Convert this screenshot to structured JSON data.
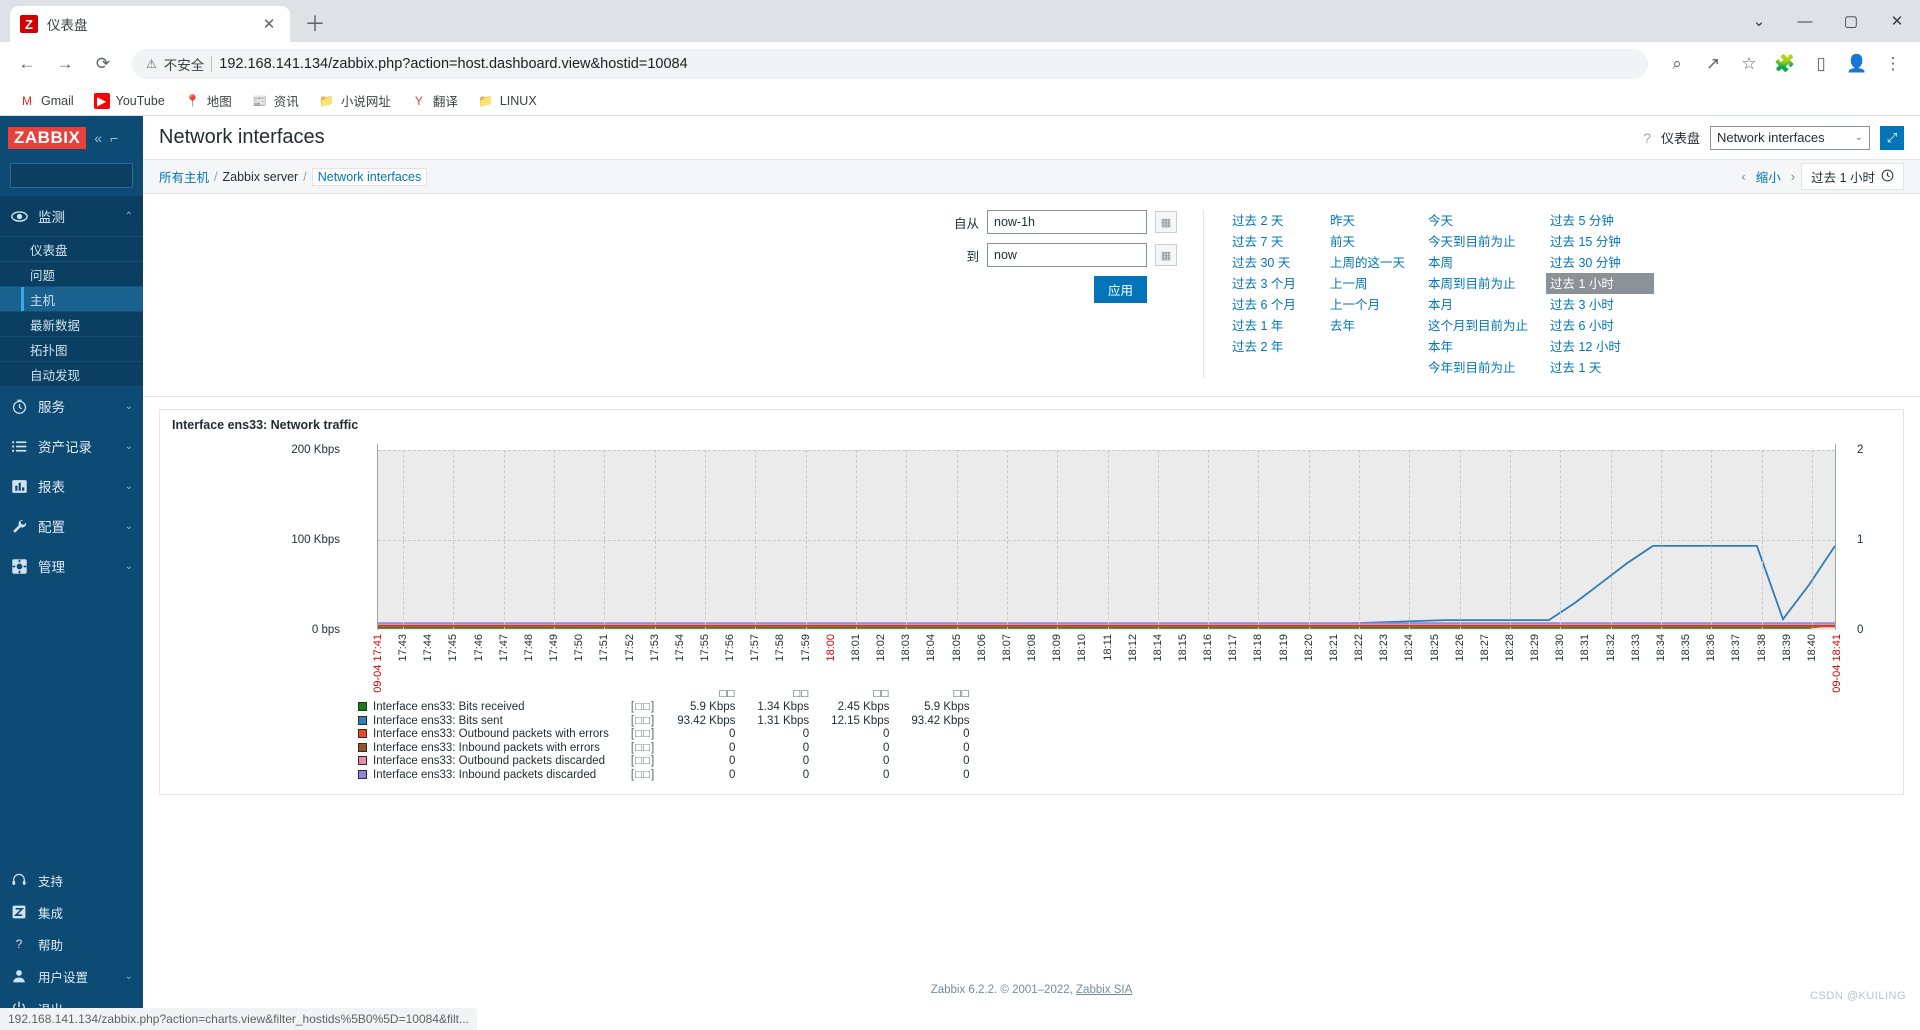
{
  "browser": {
    "tab": {
      "title": "仪表盘",
      "favicon_letter": "Z",
      "close_glyph": "✕"
    },
    "newtab_glyph": "＋",
    "window_controls": {
      "minimize": "—",
      "maximize": "▢",
      "close": "✕",
      "chevron": "⌄"
    },
    "nav": {
      "back": "←",
      "forward": "→",
      "reload": "⟳"
    },
    "omnibox": {
      "warn_glyph": "⚠",
      "security_label": "不安全",
      "url": "192.168.141.134/zabbix.php?action=host.dashboard.view&hostid=10084"
    },
    "toolbar_right": [
      {
        "name": "zoom-search-icon",
        "glyph": "⌕"
      },
      {
        "name": "share-icon",
        "glyph": "↗"
      },
      {
        "name": "bookmark-star-icon",
        "glyph": "☆"
      },
      {
        "name": "extensions-icon",
        "glyph": "🧩"
      },
      {
        "name": "sidepanel-icon",
        "glyph": "▯"
      },
      {
        "name": "profile-icon",
        "glyph": "👤"
      },
      {
        "name": "menu-icon",
        "glyph": "⋮"
      }
    ],
    "bookmarks": [
      {
        "label": "Gmail",
        "icon": "M",
        "color": "#d93025",
        "bg": "transparent"
      },
      {
        "label": "YouTube",
        "icon": "▶",
        "color": "#ffffff",
        "bg": "#ff0000"
      },
      {
        "label": "地图",
        "icon": "📍",
        "color": "#ffffff",
        "bg": "transparent"
      },
      {
        "label": "资讯",
        "icon": "📰",
        "color": "#ffffff",
        "bg": "transparent"
      },
      {
        "label": "小说网址",
        "icon": "📁",
        "color": "#f7cb4d",
        "bg": "transparent"
      },
      {
        "label": "翻译",
        "icon": "Y",
        "color": "#e8403a",
        "bg": "transparent"
      },
      {
        "label": "LINUX",
        "icon": "📁",
        "color": "#f7cb4d",
        "bg": "transparent"
      }
    ],
    "status_bar": "192.168.141.134/zabbix.php?action=charts.view&filter_hostids%5B0%5D=10084&filt..."
  },
  "sidebar": {
    "logo": "ZABBIX",
    "collapse_glyph": "«",
    "hide_glyph": "⌐",
    "search_placeholder": "",
    "groups": [
      {
        "label": "监测",
        "icon": "eye-icon",
        "expanded": true,
        "chevron": "⌃",
        "items": [
          {
            "label": "仪表盘",
            "selected": false
          },
          {
            "label": "问题",
            "selected": false
          },
          {
            "label": "主机",
            "selected": true
          },
          {
            "label": "最新数据",
            "selected": false
          },
          {
            "label": "拓扑图",
            "selected": false
          },
          {
            "label": "自动发现",
            "selected": false
          }
        ]
      },
      {
        "label": "服务",
        "icon": "clock-icon",
        "expanded": false,
        "chevron": "⌄",
        "items": []
      },
      {
        "label": "资产记录",
        "icon": "list-icon",
        "expanded": false,
        "chevron": "⌄",
        "items": []
      },
      {
        "label": "报表",
        "icon": "chart-icon",
        "expanded": false,
        "chevron": "⌄",
        "items": []
      },
      {
        "label": "配置",
        "icon": "wrench-icon",
        "expanded": false,
        "chevron": "⌄",
        "items": []
      },
      {
        "label": "管理",
        "icon": "gear-icon",
        "expanded": false,
        "chevron": "⌄",
        "items": []
      }
    ],
    "bottom": [
      {
        "label": "支持",
        "icon": "headset-icon",
        "chevron": ""
      },
      {
        "label": "集成",
        "icon": "zabbix-z-icon",
        "chevron": ""
      },
      {
        "label": "帮助",
        "icon": "question-icon",
        "chevron": ""
      },
      {
        "label": "用户设置",
        "icon": "user-icon",
        "chevron": "⌄"
      },
      {
        "label": "退出",
        "icon": "power-icon",
        "chevron": ""
      }
    ]
  },
  "header": {
    "title": "Network interfaces",
    "help_glyph": "?",
    "dashboard_label": "仪表盘",
    "dashboard_selected": "Network interfaces",
    "dashboard_chevron": "⌄",
    "kiosk_glyph": "⤢"
  },
  "breadcrumb": {
    "items": [
      {
        "label": "所有主机",
        "type": "link"
      },
      {
        "label": "Zabbix server",
        "type": "text"
      },
      {
        "label": "Network interfaces",
        "type": "selected"
      }
    ],
    "separator": "/",
    "zoom_prev": "‹",
    "zoom_label": "缩小",
    "zoom_next": "›",
    "range_label": "过去 1 小时",
    "clock_glyph": "🕘"
  },
  "timepanel": {
    "from_label": "自从",
    "from_value": "now-1h",
    "to_label": "到",
    "to_value": "now",
    "calendar_glyph": "▦",
    "apply_label": "应用",
    "columns": [
      {
        "options": [
          {
            "label": "过去 2 天",
            "selected": false
          },
          {
            "label": "过去 7 天",
            "selected": false
          },
          {
            "label": "过去 30 天",
            "selected": false
          },
          {
            "label": "过去 3 个月",
            "selected": false
          },
          {
            "label": "过去 6 个月",
            "selected": false
          },
          {
            "label": "过去 1 年",
            "selected": false
          },
          {
            "label": "过去 2 年",
            "selected": false
          }
        ]
      },
      {
        "options": [
          {
            "label": "昨天",
            "selected": false
          },
          {
            "label": "前天",
            "selected": false
          },
          {
            "label": "上周的这一天",
            "selected": false
          },
          {
            "label": "上一周",
            "selected": false
          },
          {
            "label": "上一个月",
            "selected": false
          },
          {
            "label": "去年",
            "selected": false
          }
        ]
      },
      {
        "options": [
          {
            "label": "今天",
            "selected": false
          },
          {
            "label": "今天到目前为止",
            "selected": false
          },
          {
            "label": "本周",
            "selected": false
          },
          {
            "label": "本周到目前为止",
            "selected": false
          },
          {
            "label": "本月",
            "selected": false
          },
          {
            "label": "这个月到目前为止",
            "selected": false
          },
          {
            "label": "本年",
            "selected": false
          },
          {
            "label": "今年到目前为止",
            "selected": false
          }
        ]
      },
      {
        "options": [
          {
            "label": "过去 5 分钟",
            "selected": false
          },
          {
            "label": "过去 15 分钟",
            "selected": false
          },
          {
            "label": "过去 30 分钟",
            "selected": false
          },
          {
            "label": "过去 1 小时",
            "selected": true
          },
          {
            "label": "过去 3 小时",
            "selected": false
          },
          {
            "label": "过去 6 小时",
            "selected": false
          },
          {
            "label": "过去 12 小时",
            "selected": false
          },
          {
            "label": "过去 1 天",
            "selected": false
          }
        ]
      }
    ]
  },
  "widget": {
    "title": "Interface ens33: Network traffic"
  },
  "chart_data": {
    "type": "line",
    "title": "Interface ens33: Network traffic",
    "xlabel": "",
    "ylabel": "",
    "grid": true,
    "legend_position": "bottom",
    "y_left": {
      "ticks": [
        "0 bps",
        "100 Kbps",
        "200 Kbps"
      ],
      "values": [
        0,
        100000,
        200000
      ],
      "ylim": [
        0,
        200000
      ]
    },
    "y_right": {
      "ticks": [
        "0",
        "1",
        "2"
      ],
      "values": [
        0,
        1,
        2
      ],
      "ylim": [
        0,
        2
      ]
    },
    "x_start_label": "09-04 17:41",
    "x_end_label": "09-04 18:41",
    "x": [
      "17:43",
      "17:44",
      "17:45",
      "17:46",
      "17:47",
      "17:48",
      "17:49",
      "17:50",
      "17:51",
      "17:52",
      "17:53",
      "17:54",
      "17:55",
      "17:56",
      "17:57",
      "17:58",
      "17:59",
      "18:00",
      "18:01",
      "18:02",
      "18:03",
      "18:04",
      "18:05",
      "18:06",
      "18:07",
      "18:08",
      "18:09",
      "18:10",
      "18:11",
      "18:12",
      "18:14",
      "18:15",
      "18:16",
      "18:17",
      "18:18",
      "18:19",
      "18:20",
      "18:21",
      "18:22",
      "18:23",
      "18:24",
      "18:25",
      "18:26",
      "18:27",
      "18:28",
      "18:29",
      "18:30",
      "18:31",
      "18:32",
      "18:33",
      "18:34",
      "18:35",
      "18:36",
      "18:37",
      "18:38",
      "18:39",
      "18:40"
    ],
    "x_highlight": "18:00",
    "series": [
      {
        "name": "Interface ens33: Bits received",
        "color": "#1a7a1a",
        "axis": "left",
        "values": [
          2450,
          2450,
          2450,
          2450,
          2450,
          2450,
          2450,
          2450,
          2450,
          2450,
          2450,
          2450,
          2450,
          2450,
          2450,
          2450,
          2450,
          2450,
          2450,
          2450,
          2450,
          2450,
          2450,
          2450,
          2450,
          2450,
          2450,
          2450,
          2450,
          2450,
          2450,
          2450,
          2450,
          2450,
          2450,
          2450,
          2450,
          2450,
          2450,
          2450,
          2450,
          2450,
          2450,
          2450,
          2450,
          2450,
          2450,
          2450,
          2450,
          2450,
          2450,
          2450,
          2450,
          2450,
          2450,
          2450,
          5900
        ]
      },
      {
        "name": "Interface ens33: Bits sent",
        "color": "#2f7cb8",
        "axis": "left",
        "values": [
          7000,
          7000,
          7000,
          7000,
          7000,
          7000,
          7000,
          7000,
          7000,
          7000,
          7000,
          7000,
          7000,
          7000,
          7000,
          7000,
          7000,
          7000,
          7000,
          7000,
          7000,
          7000,
          7000,
          7000,
          7000,
          7000,
          7000,
          7000,
          7000,
          7000,
          7000,
          7000,
          7000,
          7000,
          7000,
          7000,
          7000,
          7000,
          8000,
          9000,
          10000,
          11000,
          11000,
          11000,
          11000,
          11000,
          30000,
          52000,
          74000,
          93420,
          93420,
          93420,
          93420,
          93420,
          12000,
          50000,
          93420
        ]
      },
      {
        "name": "Interface ens33: Outbound packets with errors",
        "color": "#ea4a24",
        "axis": "right",
        "values": []
      },
      {
        "name": "Interface ens33: Inbound packets with errors",
        "color": "#9a5226",
        "axis": "right",
        "values": []
      },
      {
        "name": "Interface ens33: Outbound packets discarded",
        "color": "#f087b2",
        "axis": "right",
        "values": []
      },
      {
        "name": "Interface ens33: Inbound packets discarded",
        "color": "#8b84e0",
        "axis": "right",
        "values": []
      }
    ],
    "legend_headers": [
      "□□",
      "□□",
      "□□",
      "□□"
    ],
    "legend_rows": [
      {
        "name": "Interface ens33: Bits received",
        "color": "#1a7a1a",
        "tofu": "[□□]",
        "cells": [
          "5.9 Kbps",
          "1.34 Kbps",
          "2.45 Kbps",
          "5.9 Kbps"
        ]
      },
      {
        "name": "Interface ens33: Bits sent",
        "color": "#2f7cb8",
        "tofu": "[□□]",
        "cells": [
          "93.42 Kbps",
          "1.31 Kbps",
          "12.15 Kbps",
          "93.42 Kbps"
        ]
      },
      {
        "name": "Interface ens33: Outbound packets with errors",
        "color": "#ea4a24",
        "tofu": "[□□]",
        "cells": [
          "0",
          "0",
          "0",
          "0"
        ]
      },
      {
        "name": "Interface ens33: Inbound packets with errors",
        "color": "#9a5226",
        "tofu": "[□□]",
        "cells": [
          "0",
          "0",
          "0",
          "0"
        ]
      },
      {
        "name": "Interface ens33: Outbound packets discarded",
        "color": "#f087b2",
        "tofu": "[□□]",
        "cells": [
          "0",
          "0",
          "0",
          "0"
        ]
      },
      {
        "name": "Interface ens33: Inbound packets discarded",
        "color": "#8b84e0",
        "tofu": "[□□]",
        "cells": [
          "0",
          "0",
          "0",
          "0"
        ]
      }
    ]
  },
  "footer": {
    "text": "Zabbix 6.2.2. © 2001–2022,",
    "link": "Zabbix SIA",
    "watermark": "CSDN @KUILING"
  }
}
